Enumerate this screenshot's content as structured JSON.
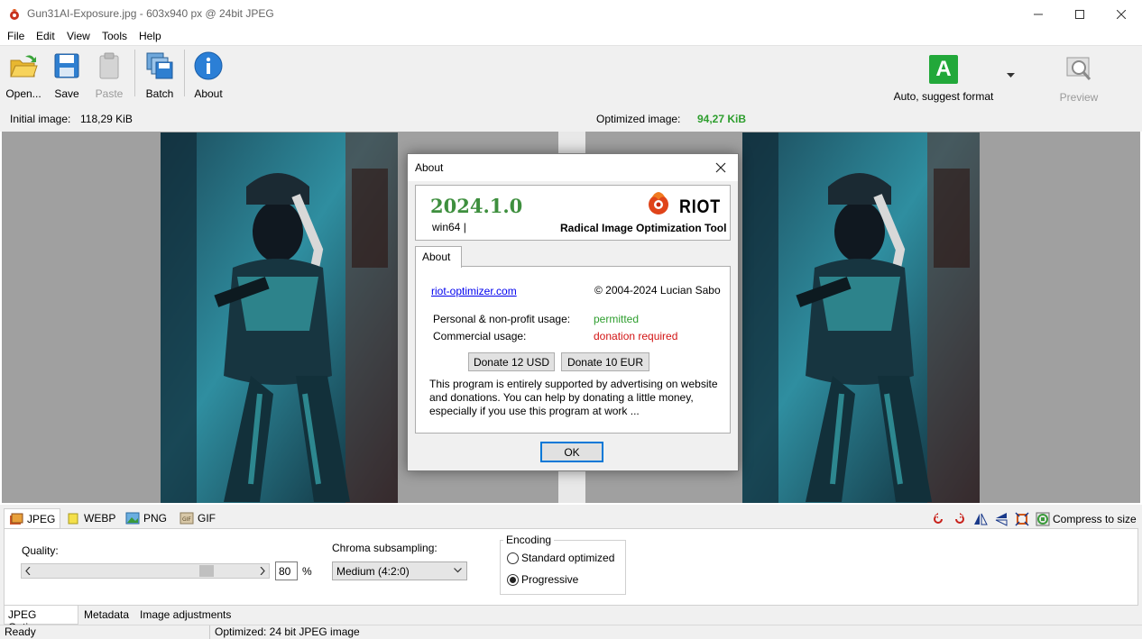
{
  "window": {
    "title": "Gun31AI-Exposure.jpg - 603x940 px @ 24bit JPEG"
  },
  "menu": [
    "File",
    "Edit",
    "View",
    "Tools",
    "Help"
  ],
  "toolbar": {
    "open": "Open...",
    "save": "Save",
    "paste": "Paste",
    "batch": "Batch",
    "about": "About",
    "format": "Auto, suggest format",
    "format_badge": "A",
    "preview": "Preview"
  },
  "info": {
    "initial_label": "Initial image:",
    "initial_value": "118,29 KiB",
    "optimized_label": "Optimized image:",
    "optimized_value": "94,27 KiB"
  },
  "format_tabs": [
    "JPEG",
    "WEBP",
    "PNG",
    "GIF"
  ],
  "compress_to_size": "Compress to size",
  "options": {
    "quality_label": "Quality:",
    "quality_value": "80",
    "quality_unit": "%",
    "chroma_label": "Chroma subsampling:",
    "chroma_value": "Medium (4:2:0)",
    "encoding_label": "Encoding",
    "encoding_options": [
      "Standard optimized",
      "Progressive"
    ],
    "encoding_selected": "Progressive"
  },
  "bottom_tabs": [
    "JPEG Options",
    "Metadata",
    "Image adjustments"
  ],
  "status": {
    "left": "Ready",
    "right": "Optimized: 24 bit JPEG image"
  },
  "dialog": {
    "title": "About",
    "version": "2024.1.0",
    "platform": "win64 |",
    "logo_text": "RIOT",
    "product_name": "Radical Image Optimization Tool",
    "tab": "About",
    "link": "riot-optimizer.com",
    "copyright": "© 2004-2024 Lucian Sabo",
    "personal_label": "Personal & non-profit usage:",
    "personal_value": "permitted",
    "commercial_label": "Commercial usage:",
    "commercial_value": "donation required",
    "donate_usd": "Donate 12 USD",
    "donate_eur": "Donate 10 EUR",
    "desc_line1": "This program is entirely supported by advertising on website",
    "desc_line2": "and donations. You can help by donating a little money,",
    "desc_line3": "especially if you use this program at work ...",
    "ok": "OK"
  },
  "colors": {
    "permitted": "#2e9e2e",
    "donation_required": "#d21414",
    "version": "#3e8f3e",
    "optimized_size": "#2e9e2e",
    "accent_focus": "#0078d7"
  }
}
